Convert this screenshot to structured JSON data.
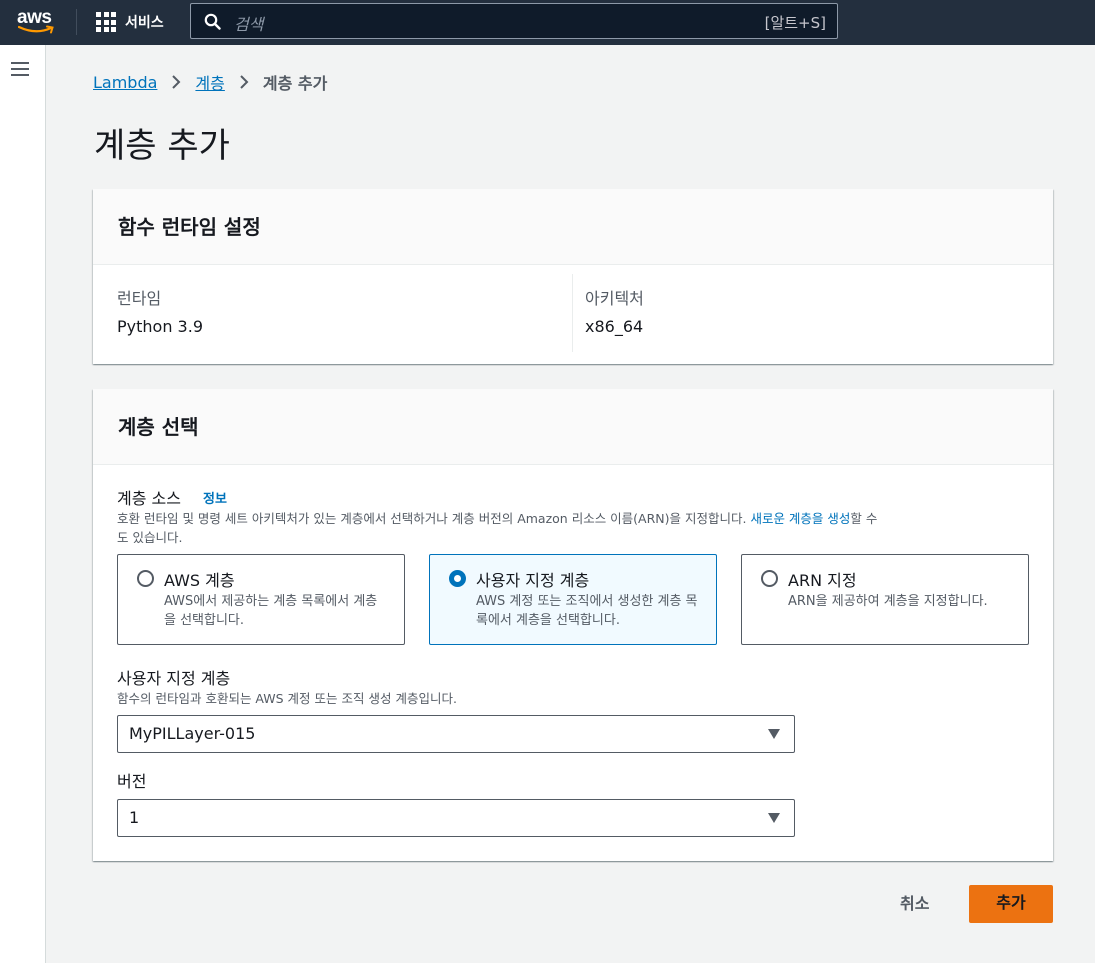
{
  "nav": {
    "logo": "aws",
    "services_label": "서비스",
    "search_placeholder": "검색",
    "search_shortcut": "[알트+S]"
  },
  "breadcrumb": {
    "items": [
      "Lambda",
      "계층"
    ],
    "current": "계층 추가"
  },
  "page_title": "계층 추가",
  "runtime_panel": {
    "title": "함수 런타임 설정",
    "runtime_label": "런타임",
    "runtime_value": "Python 3.9",
    "arch_label": "아키텍처",
    "arch_value": "x86_64"
  },
  "layer_panel": {
    "title": "계층 선택",
    "source_label": "계층 소스",
    "info_link": "정보",
    "source_desc_1": "호환 런타임 및 명령 세트 아키텍처가 있는 계층에서 선택하거나 계층 버전의 Amazon 리소스 이름(ARN)을 지정합니다.",
    "source_desc_link": "새로운 계층을 생성",
    "source_desc_2": "할 수",
    "source_desc_3": "도 있습니다.",
    "options": [
      {
        "label": "AWS 계층",
        "desc": "AWS에서 제공하는 계층 목록에서 계층을 선택합니다.",
        "selected": false
      },
      {
        "label": "사용자 지정 계층",
        "desc": "AWS 계정 또는 조직에서 생성한 계층 목록에서 계층을 선택합니다.",
        "selected": true
      },
      {
        "label": "ARN 지정",
        "desc": "ARN을 제공하여 계층을 지정합니다.",
        "selected": false
      }
    ],
    "custom_layer_label": "사용자 지정 계층",
    "custom_layer_desc": "함수의 런타임과 호환되는 AWS 계정 또는 조직 생성 계층입니다.",
    "custom_layer_value": "MyPILLayer-015",
    "version_label": "버전",
    "version_value": "1"
  },
  "actions": {
    "cancel": "취소",
    "add": "추가"
  },
  "colors": {
    "nav_bg": "#232f3e",
    "link": "#0073bb",
    "primary_button": "#ec7211",
    "smile": "#ff9900"
  }
}
